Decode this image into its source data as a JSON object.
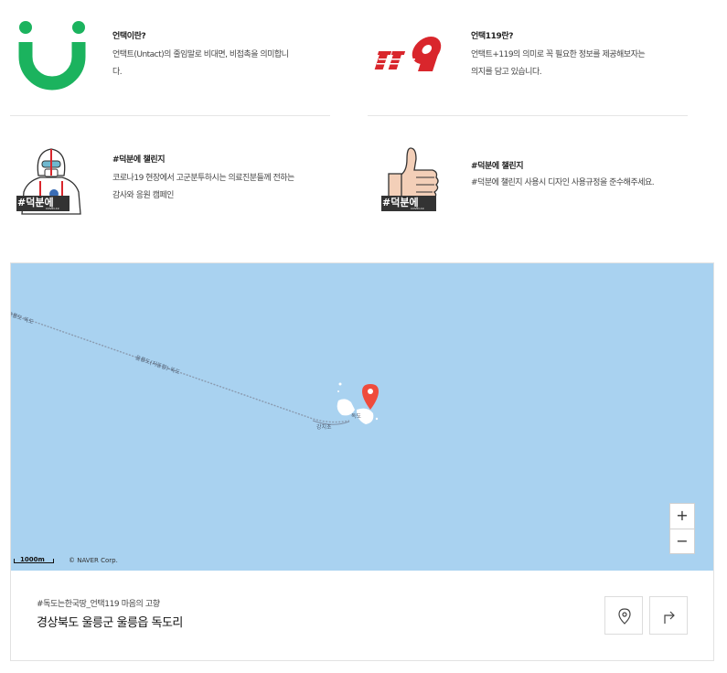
{
  "cards": [
    {
      "title": "언택이란?",
      "desc": "언택트(Untact)의 줄임말로 비대면, 비접촉을 의미합니다.",
      "logo": "untact-u-logo"
    },
    {
      "title": "언택119란?",
      "desc": "언택트+119의 의미로 꼭 필요한 정보를 제공해보자는 의지를 담고 있습니다.",
      "logo": "119-logo"
    },
    {
      "title": "#덕분에 챌린지",
      "desc": "코로나19 현장에서 고군분투하시는 의료진분들께 전하는 감사와 응원 캠페인",
      "logo": "medical-staff-illustration",
      "badge": "#덕분에",
      "badge_sub": "COVID-19"
    },
    {
      "title": "#덕분에 챌린지",
      "desc": "#덕분에 챌린지 사용시 디자인 사용규정을 준수해주세요.",
      "logo": "thumbs-up-illustration",
      "badge": "#덕분에",
      "badge_sub": "COVID-19"
    }
  ],
  "map": {
    "route_label_1": "울릉도-독도",
    "route_label_2": "울릉도(저동항)-독도",
    "place_label": "독도",
    "place_label_2": "강치초",
    "zoom_in": "+",
    "zoom_out": "−",
    "scale": "1000m",
    "copyright": "© NAVER Corp.",
    "colors": {
      "sea": "#a9d2f0",
      "marker": "#ef4b3c"
    }
  },
  "address": {
    "subtitle": "#독도는한국땅_언택119 마음의 고향",
    "title": "경상북도 울릉군 울릉읍 독도리"
  },
  "buttons": {
    "location": "location-pin-icon",
    "directions": "directions-icon"
  }
}
